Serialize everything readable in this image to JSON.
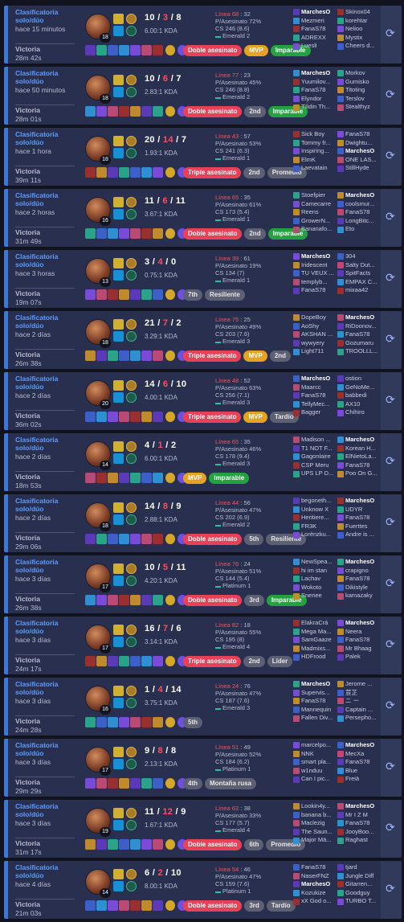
{
  "matches": [
    {
      "mode": "Clasificatoria solo/dúo",
      "ago": "hace 15 minutos",
      "result": "Victoria",
      "duration": "28m 42s",
      "level": "18",
      "k": "10",
      "d": "3",
      "a": "8",
      "ratio": "6.00:1 KDA",
      "kp": "Línea 68",
      "kpv": "32",
      "kill_pct": "P/Asesinato 72%",
      "cs": "CS 246 (8.6)",
      "rank": "Emerald 2",
      "badges": [
        [
          "Doble asesinato",
          "red"
        ],
        [
          "MVP",
          "gold"
        ],
        [
          "Imparable",
          "green"
        ]
      ],
      "team1": [
        "MarchesO",
        "Mezmeri",
        "FanaS78",
        "ADREXX",
        "Luesli"
      ],
      "team2": [
        "Skinox04",
        "korehtar",
        "Nelioo",
        "Mystix",
        "Cheers d..."
      ]
    },
    {
      "mode": "Clasificatoria solo/dúo",
      "ago": "hace 50 minutos",
      "result": "Victoria",
      "duration": "28m 01s",
      "level": "18",
      "k": "10",
      "d": "6",
      "a": "7",
      "ratio": "2.83:1 KDA",
      "kp": "Línea 77",
      "kpv": "23",
      "kill_pct": "P/Asesinato 45%",
      "cs": "CS 246 (8.8)",
      "rank": "Emerald 2",
      "badges": [
        [
          "Doble asesinato",
          "red"
        ],
        [
          "2nd",
          "grey"
        ],
        [
          "Imparable",
          "green"
        ]
      ],
      "team1": [
        "MarchesO",
        "Yuumilov...",
        "FanaS78",
        "Elyndor",
        "Tilidin Th..."
      ],
      "team2": [
        "Morkov",
        "Gumisko",
        "Titoting",
        "Terslov",
        "Stealthyz"
      ]
    },
    {
      "mode": "Clasificatoria solo/dúo",
      "ago": "hace 1 hora",
      "result": "Victoria",
      "duration": "39m 11s",
      "level": "18",
      "k": "20",
      "d": "14",
      "a": "7",
      "ratio": "1.93:1 KDA",
      "kp": "Línea 43",
      "kpv": "57",
      "kill_pct": "P/Asesinato 53%",
      "cs": "CS 241 (6.3)",
      "rank": "Emerald 1",
      "badges": [
        [
          "Triple asesinato",
          "red"
        ],
        [
          "2nd",
          "grey"
        ],
        [
          "Promedio",
          "grey"
        ]
      ],
      "team1": [
        "Sick Boy",
        "Tommy fr...",
        "Inspiring...",
        "ElmK",
        "Laevatain"
      ],
      "team2": [
        "FanaS78",
        "Dwightu...",
        "MarchesO",
        "ONE LAS...",
        "StillHyde"
      ]
    },
    {
      "mode": "Clasificatoria solo/dúo",
      "ago": "hace 2 horas",
      "result": "Victoria",
      "duration": "31m 49s",
      "level": "16",
      "k": "11",
      "d": "6",
      "a": "11",
      "ratio": "3.67:1 KDA",
      "kp": "Línea 65",
      "kpv": "35",
      "kill_pct": "P/Asesinato 61%",
      "cs": "CS 173 (5.4)",
      "rank": "Emerald 1",
      "badges": [
        [
          "Doble asesinato",
          "red"
        ],
        [
          "2nd",
          "grey"
        ],
        [
          "Imparable",
          "green"
        ]
      ],
      "team1": [
        "Stoefpier",
        "Camecarre",
        "Reens",
        "GrowerN...",
        "Bananafo..."
      ],
      "team2": [
        "MarchesO",
        "coolsmur...",
        "FanaS78",
        "LongBitc...",
        "Eto"
      ]
    },
    {
      "mode": "Clasificatoria solo/dúo",
      "ago": "hace 3 horas",
      "result": "Victoria",
      "duration": "19m 07s",
      "level": "13",
      "k": "3",
      "d": "4",
      "a": "0",
      "ratio": "0.75:1 KDA",
      "kp": "Línea 39",
      "kpv": "61",
      "kill_pct": "P/Asesinato 19%",
      "cs": "CS 134 (7)",
      "rank": "Emerald 1",
      "badges": [
        [
          "7th",
          "grey"
        ],
        [
          "Resiliente",
          "grey"
        ]
      ],
      "team1": [
        "MarchesO",
        "Iridescent",
        "TU VEUX ...",
        "templyb...",
        "FanaS78"
      ],
      "team2": [
        "304",
        "Salty Dut...",
        "SpitFacts",
        "EMPAX C...",
        "mixaa42"
      ]
    },
    {
      "mode": "Clasificatoria solo/dúo",
      "ago": "hace 2 días",
      "result": "Victoria",
      "duration": "26m 38s",
      "level": "18",
      "k": "21",
      "d": "7",
      "a": "2",
      "ratio": "3.29:1 KDA",
      "kp": "Línea 75",
      "kpv": "25",
      "kill_pct": "P/Asesinato 49%",
      "cs": "CS 203 (7.6)",
      "rank": "Emerald 3",
      "badges": [
        [
          "Triple asesinato",
          "red"
        ],
        [
          "MVP",
          "gold"
        ],
        [
          "2nd",
          "grey"
        ]
      ],
      "team1": [
        "DopeBoy",
        "AoShy",
        "AKSHAN ...",
        "wywyery",
        "Light711"
      ],
      "team2": [
        "MarchesO",
        "RiDoonov...",
        "FanaS78",
        "Gozumaru",
        "TROOLLL..."
      ]
    },
    {
      "mode": "Clasificatoria solo/dúo",
      "ago": "hace 2 días",
      "result": "Victoria",
      "duration": "36m 02s",
      "level": "20",
      "k": "14",
      "d": "6",
      "a": "10",
      "ratio": "4.00:1 KDA",
      "kp": "Línea 48",
      "kpv": "52",
      "kill_pct": "P/Asesinato 63%",
      "cs": "CS 256 (7.1)",
      "rank": "Emerald 3",
      "badges": [
        [
          "Triple asesinato",
          "red"
        ],
        [
          "MVP",
          "gold"
        ],
        [
          "Tardío",
          "grey"
        ]
      ],
      "team1": [
        "MarchesO",
        "Maarcc",
        "FanaS78",
        "TellyMec...",
        "Bagger"
      ],
      "team2": [
        "ostion",
        "GeNoMe...",
        "babbedi",
        "AX10",
        "Chihiro"
      ]
    },
    {
      "mode": "Clasificatoria solo/dúo",
      "ago": "hace 2 días",
      "result": "Victoria",
      "duration": "18m 53s",
      "level": "14",
      "k": "4",
      "d": "1",
      "a": "2",
      "ratio": "6.00:1 KDA",
      "kp": "Línea 65",
      "kpv": "35",
      "kill_pct": "P/Asesinato 46%",
      "cs": "CS 178 (9.4)",
      "rank": "Emerald 3",
      "badges": [
        [
          "MVP",
          "gold"
        ],
        [
          "Imparable",
          "green"
        ]
      ],
      "team1": [
        "Madison ...",
        "T1 NOT F...",
        "Gagonlaire",
        "CSP Meru",
        "UPS LP D..."
      ],
      "team2": [
        "MarchesO",
        "Korean H...",
        "ElNietoLa...",
        "FanaS78",
        "Poo On G..."
      ]
    },
    {
      "mode": "Clasificatoria solo/dúo",
      "ago": "hace 2 días",
      "result": "Victoria",
      "duration": "29m 06s",
      "level": "18",
      "k": "14",
      "d": "8",
      "a": "9",
      "ratio": "2.88:1 KDA",
      "kp": "Línea 44",
      "kpv": "56",
      "kill_pct": "P/Asesinato 47%",
      "cs": "CS 202 (6.9)",
      "rank": "Emerald 2",
      "badges": [
        [
          "Doble asesinato",
          "red"
        ],
        [
          "5th",
          "grey"
        ],
        [
          "Resiliente",
          "grey"
        ]
      ],
      "team1": [
        "begoneth...",
        "Unknow X",
        "Heritiere...",
        "FR3K",
        "Lorènzku..."
      ],
      "team2": [
        "MarchesO",
        "UDYR",
        "FanaS78",
        "Fuerttes",
        "Andre is ..."
      ]
    },
    {
      "mode": "Clasificatoria solo/dúo",
      "ago": "hace 3 días",
      "result": "Victoria",
      "duration": "26m 38s",
      "level": "17",
      "k": "10",
      "d": "5",
      "a": "11",
      "ratio": "4.20:1 KDA",
      "kp": "Línea 76",
      "kpv": "24",
      "kill_pct": "P/Asesinato 51%",
      "cs": "CS 144 (5.4)",
      "rank": "Platinum 1",
      "badges": [
        [
          "Doble asesinato",
          "red"
        ],
        [
          "3rd",
          "grey"
        ],
        [
          "Imparable",
          "green"
        ]
      ],
      "team1": [
        "NewSpea...",
        "hi im stan",
        "Lachav",
        "Wokoto",
        "Snenee"
      ],
      "team2": [
        "MarchesO",
        "crapigno",
        "FanaS78",
        "Dikistyle",
        "kamazaky"
      ]
    },
    {
      "mode": "Clasificatoria solo/dúo",
      "ago": "hace 3 días",
      "result": "Victoria",
      "duration": "24m 17s",
      "level": "17",
      "k": "16",
      "d": "7",
      "a": "6",
      "ratio": "3.14:1 KDA",
      "kp": "Línea 82",
      "kpv": "18",
      "kill_pct": "P/Asesinato 55%",
      "cs": "CS 195 (8)",
      "rank": "Emerald 4",
      "badges": [
        [
          "Triple asesinato",
          "red"
        ],
        [
          "2nd",
          "grey"
        ],
        [
          "Líder",
          "grey"
        ]
      ],
      "team1": [
        "ElakraCrá",
        "Mega Ma...",
        "SamGaaze",
        "Madmixs...",
        "HDFrood"
      ],
      "team2": [
        "MarchesO",
        "Neera",
        "FanaS78",
        "Mr Bhaag",
        "Palek"
      ]
    },
    {
      "mode": "Clasificatoria solo/dúo",
      "ago": "hace 3 días",
      "result": "Victoria",
      "duration": "24m 28s",
      "level": "16",
      "k": "1",
      "d": "4",
      "a": "14",
      "ratio": "3.75:1 KDA",
      "kp": "Línea 24",
      "kpv": "76",
      "kill_pct": "P/Asesinato 47%",
      "cs": "CS 187 (7.6)",
      "rank": "Emerald 3",
      "badges": [
        [
          "5th",
          "grey"
        ]
      ],
      "team1": [
        "MarchesO",
        "Supervis...",
        "FanaS78",
        "Mannequin",
        "Fallen Div..."
      ],
      "team2": [
        "Jerome ...",
        "荳芷",
        "ニ ー",
        "Captain ...",
        "Persepho..."
      ]
    },
    {
      "mode": "Clasificatoria solo/dúo",
      "ago": "hace 3 días",
      "result": "Victoria",
      "duration": "29m 29s",
      "level": "17",
      "k": "9",
      "d": "8",
      "a": "8",
      "ratio": "2.13:1 KDA",
      "kp": "Línea 51",
      "kpv": "49",
      "kill_pct": "P/Asesinato 52%",
      "cs": "CS 184 (6.2)",
      "rank": "Platinum 1",
      "badges": [
        [
          "4th",
          "grey"
        ],
        [
          "Montaña rusa",
          "grey"
        ]
      ],
      "team1": [
        "marcelpo...",
        "NNK",
        "smart pla...",
        "w1nduu",
        "Can I pic..."
      ],
      "team2": [
        "MarchesO",
        "MecXa",
        "FanaS78",
        "Blue",
        "Freiä"
      ]
    },
    {
      "mode": "Clasificatoria solo/dúo",
      "ago": "hace 3 días",
      "result": "Victoria",
      "duration": "31m 17s",
      "level": "19",
      "k": "11",
      "d": "12",
      "a": "9",
      "ratio": "1.67:1 KDA",
      "kp": "Línea 62",
      "kpv": "38",
      "kill_pct": "P/Asesinato 33%",
      "cs": "CS 177 (5.7)",
      "rank": "Emerald 4",
      "badges": [
        [
          "Doble asesinato",
          "red"
        ],
        [
          "6th",
          "grey"
        ],
        [
          "Promedio",
          "grey"
        ]
      ],
      "team1": [
        "Lookin4y...",
        "banana b...",
        "Maclezig",
        "The Saun...",
        "Major Mä..."
      ],
      "team2": [
        "MarchesO",
        "Mr I Z M",
        "FanaS78",
        "JooyBoo...",
        "Raghast"
      ]
    },
    {
      "mode": "Clasificatoria solo/dúo",
      "ago": "hace 4 días",
      "result": "Victoria",
      "duration": "21m 03s",
      "level": "14",
      "k": "6",
      "d": "2",
      "a": "10",
      "ratio": "8.00:1 KDA",
      "kp": "Línea 54",
      "kpv": "46",
      "kill_pct": "P/Asesinato 47%",
      "cs": "CS 159 (7.6)",
      "rank": "Platinum 1",
      "badges": [
        [
          "Doble asesinato",
          "red"
        ],
        [
          "3rd",
          "grey"
        ],
        [
          "Tardío",
          "grey"
        ]
      ],
      "team1": [
        "FanaS78",
        "NaserFNZ",
        "MarchesO",
        "Kozukize",
        "xX God o..."
      ],
      "team2": [
        "tjard",
        "Jungle Diff",
        "Gitarren...",
        "Goodguy",
        "TURBO T..."
      ]
    }
  ]
}
